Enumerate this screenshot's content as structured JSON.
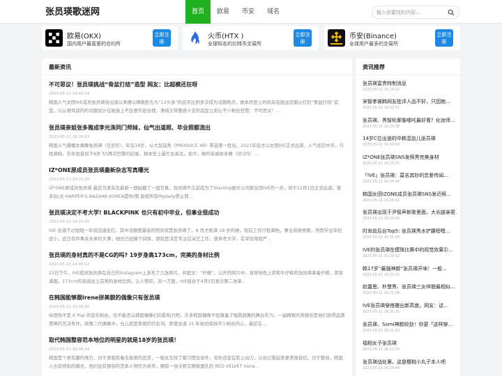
{
  "site": {
    "title": "张员瑛歌迷网"
  },
  "nav": {
    "items": [
      {
        "label": "首页"
      },
      {
        "label": "欧易"
      },
      {
        "label": "币安"
      },
      {
        "label": "域名"
      }
    ]
  },
  "search": {
    "placeholder": "输入你要找的内容..."
  },
  "exchanges": [
    {
      "name": "欧易(OKX)",
      "desc": "国内用户最喜爱的合约所",
      "btn": "立即注册",
      "icon": "okx-logo-icon"
    },
    {
      "name": "火币(HTX )",
      "desc": "全球知名的比特币交易所",
      "btn": "立即注册",
      "icon": "htx-logo-icon"
    },
    {
      "name": "币安(Binance)",
      "desc": "全球用户最多的交易所",
      "btn": "立即注册",
      "icon": "binance-logo-icon"
    }
  ],
  "latest": {
    "title": "最新资讯",
    "articles": [
      {
        "title": "不可思议！张员瑛挑战“骨盆打结”造型 网友：比超模还狂呀",
        "date": "2023-05-11 14:43:34",
        "excerpt": "韩国人气女团IVE成员张员瑛自出道以来便以精致脸孔与“12头身”的逆天比例多次成为话题焦点，她本月登上时尚杂志挑战近期火红的“骨盆打结”造型，公认难驾驭的的穷酸设计在她身上不仅意外超合理，清纯又带整感十足的造型立刻让不少粉丝狂赞：不可思议！..."
      },
      {
        "title": "张员瑛亲姐张多雅成李光洙同门师妹，仙气出道照、毕业照都流出",
        "date": "2023-05-11 16:20:33",
        "excerpt": "韩国人气爆棚女偶像张员瑛（장원영），年仅18岁，从大型选秀《PRODUCE 48》票选第一登出，2021年底才以女团IVE正式出道，人气如日中天，行程满档。去年就曾创下8天飞5两次巴黎的纪录，根本史上最忙女高生。如今，她的亲姊张多雅（장다아）..."
      },
      {
        "title": "IZ*ONE原成员张员瑛最新杂志写真曝光",
        "date": "2023-05-11 16:21:26",
        "excerpt": "IZ*ONE原成员张员瑛 最近为某杂志最新一期拍摄了一组写真。张员瑛不久前成为了Starship娱乐公司新女团IVE的一员，将于12月1日正式出道。姜多玩(文 HARPER’S BAZAAR KOREA提供/图 版权所有Mydaily禁止转..."
      },
      {
        "title": "张员瑛决定不考大学! BLACKPINK 也只有初中毕业，但事业很成功",
        "date": "2023-05-11 16:23:05",
        "excerpt": "IVE 出道不过短短一年就迅速走红，其中话题度最高的团员就是张员瑛了，8 月才刚满 18 岁的她，现在工作行程满档，事业成绩亮眼，然而学业年纪还小，近日有件事关未来的大事，她也已经做下抉择，那就是决定专注在演艺工作，放弃考大学。在学历观程严..."
      },
      {
        "title": "张员瑛的身材真的不是CG的吗? 19岁身高173cm，完美的身材比例",
        "date": "2023-05-11 14:44:12",
        "excerpt": "22日下午，IVE成员张员瑛在自己的Instagram上发布了几张照片，并配文：“柠檬”，公开的照片中，身穿绿色上衣和牛仔裤的张员瑛拿着柠檬，笑容满面。173cm的身高加上完美的身材比例，让人赞叹。另一方面，IVE组合于4月5日发行第二张单..."
      },
      {
        "title": "在韩国能够跟Irene拼美貌的偶像只有张员瑛",
        "date": "2023-05-11 15:26:10",
        "excerpt": "纵使你不是 K Pop 的忠实粉丝，也不能否认韩国偶像们的影响力吧。许多韩国偶像不但兼备了唱歌跳舞的舞台实力，一副精致的美貌也是他们获得品牌青睐的先决条件。就像二代偶像中，允儿就是美貌的代名词，即使出道 15 年依旧保持不少粉丝的心，最近在..."
      },
      {
        "title": "取代韩国整容范本地位的明星的就是18岁的张员瑛！",
        "date": "2023-05-11 16:46:34",
        "excerpt": "韩国是个很有趣的地方，对于美貌有着无极限的追求，一般女生除了都习惯化妆外，有些还会在脸上动刀，让自己看起来更美丽自信。对于整容，韩国人也有特别的模式，他们会有整容的范本人物作为参考，拥有一张冷艳又精致面孔的 RED VELVET Irene..."
      }
    ]
  },
  "recommend": {
    "title": "资讯推荐",
    "items": [
      {
        "title": "张员瑛富贵特制消息",
        "date": "2023-05-11 15:14:22"
      },
      {
        "title": "宋智孝被韩网友批评人品不好，只因她...",
        "date": "2023-05-11 16:22:51"
      },
      {
        "title": "张员瑛、秀智轮廓像哪吒最好看？化妆师...",
        "date": "2023-05-11 16:20:38"
      },
      {
        "title": "14岁C位出道的中韩混血儿张员瑛",
        "date": "2023-05-11 16:20:59"
      },
      {
        "title": "IZ*ONE张员瑛SNS发照秀完美身材",
        "date": "2023-05-11 16:25:55"
      },
      {
        "title": "「IVE」张员瑛：莫名其妙的恋爱传闻...",
        "date": "2023-05-11 16:19:44"
      },
      {
        "title": "韩国女团IZONE成员张员瑛SNS发近照...",
        "date": "2023-05-11 16:26:13"
      },
      {
        "title": "张员瑛出现于尹智声新歌里面，大长腿亲密...",
        "date": "2023-05-11 16:24:26"
      },
      {
        "title": "时尚前后台Top5: 张员瑛秀水铲腰榜嗯...",
        "date": "2023-05-11 16:25:00"
      },
      {
        "title": "IVE的张员瑛在模珠比赛中的视觉效果引...",
        "date": "2023-05-11 15:20:12"
      },
      {
        "title": "韩17岁“最强神颜”张员瑛开味！一般...",
        "date": "2023-05-11 16:23:22"
      },
      {
        "title": "赵露思、朴慧秀、张员瑛三女祥貌最相似...",
        "date": "2023-05-11 16:21:04"
      },
      {
        "title": "IVE张员瑛穿搭撒出新高度。网友：这...",
        "date": "2023-05-11 16:35:25"
      },
      {
        "title": "张员瑛、Somi神颜较劲！你更「这样穿...",
        "date": "2023-05-11 16:21:43"
      },
      {
        "title": "福相女子张员瑛",
        "date": "2023-05-11 16:52:50"
      },
      {
        "title": "张员瑛战处第。这是樱桃小丸子本人吧",
        "date": "2023-05-11 16:14:44"
      }
    ]
  }
}
